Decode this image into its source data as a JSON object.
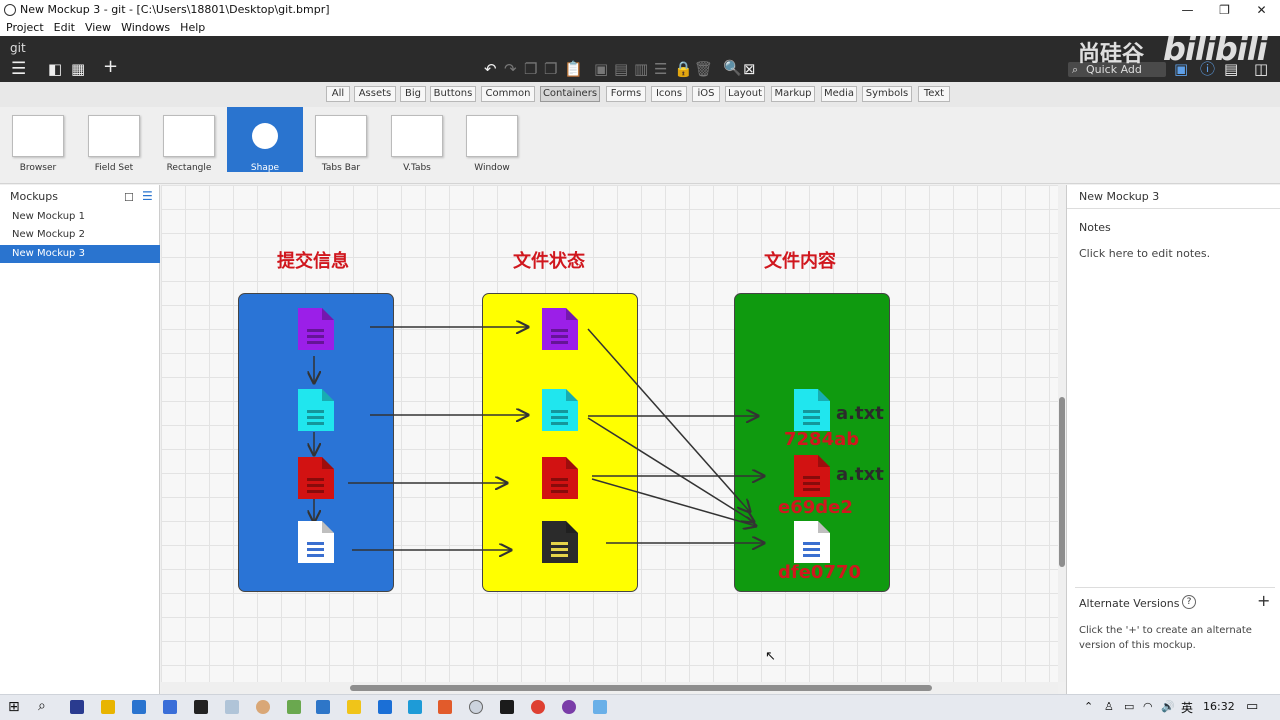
{
  "window": {
    "title": "New Mockup 3 - git - [C:\\Users\\18801\\Desktop\\git.bmpr]",
    "min": "—",
    "max": "❐",
    "close": "✕"
  },
  "menu": [
    "Project",
    "Edit",
    "View",
    "Windows",
    "Help"
  ],
  "toolbar": {
    "project_name": "git",
    "quick_add_placeholder": "Quick Add"
  },
  "watermark": {
    "cn": "尚硅谷",
    "bili": "bilibili"
  },
  "library_tabs": [
    {
      "label": "All",
      "active": false
    },
    {
      "label": "Assets",
      "active": false
    },
    {
      "label": "Big",
      "active": false
    },
    {
      "label": "Buttons",
      "active": false
    },
    {
      "label": "Common",
      "active": false
    },
    {
      "label": "Containers",
      "active": true
    },
    {
      "label": "Forms",
      "active": false
    },
    {
      "label": "Icons",
      "active": false
    },
    {
      "label": "iOS",
      "active": false
    },
    {
      "label": "Layout",
      "active": false
    },
    {
      "label": "Markup",
      "active": false
    },
    {
      "label": "Media",
      "active": false
    },
    {
      "label": "Symbols",
      "active": false
    },
    {
      "label": "Text",
      "active": false
    }
  ],
  "components": [
    {
      "label": "Browser",
      "selected": false
    },
    {
      "label": "Field Set",
      "selected": false
    },
    {
      "label": "Rectangle",
      "selected": false
    },
    {
      "label": "Shape",
      "selected": true
    },
    {
      "label": "Tabs Bar",
      "selected": false
    },
    {
      "label": "V.Tabs",
      "selected": false
    },
    {
      "label": "Window",
      "selected": false
    }
  ],
  "mockups": {
    "header": "Mockups",
    "items": [
      {
        "label": "New Mockup 1",
        "selected": false
      },
      {
        "label": "New Mockup 2",
        "selected": false
      },
      {
        "label": "New Mockup 3",
        "selected": true
      }
    ]
  },
  "right_panel": {
    "title": "New Mockup 3",
    "notes_label": "Notes",
    "notes_placeholder": "Click here to edit notes.",
    "alt_versions_label": "Alternate Versions",
    "alt_versions_help": "?",
    "alt_versions_add": "+",
    "alt_versions_text": "Click the '+' to create an alternate version of this mockup."
  },
  "diagram": {
    "titles": [
      "提交信息",
      "文件状态",
      "文件内容"
    ],
    "colors": {
      "commit_column": "#2a74d6",
      "status_column": "#ffff00",
      "content_column": "#0f9a0f",
      "purple": "#9b1fe8",
      "cyan": "#20e6ee",
      "red": "#d21212",
      "white": "#ffffff",
      "black": "#2b2b2b",
      "title_red": "#d0171e"
    },
    "commit_docs": [
      "purple-doc-icon",
      "cyan-doc-icon",
      "red-doc-icon",
      "white-doc-icon"
    ],
    "status_docs": [
      "purple-doc-icon",
      "cyan-doc-icon",
      "red-doc-icon",
      "black-doc-icon"
    ],
    "content_files": [
      {
        "name": "a.txt",
        "hash": "7284ab",
        "icon": "cyan-doc-icon"
      },
      {
        "name": "a.txt",
        "hash": "e69de2",
        "icon": "red-doc-icon"
      },
      {
        "name": "",
        "hash": "dfe0770",
        "icon": "white-doc-icon"
      }
    ]
  },
  "taskbar": {
    "ime": "英",
    "clock": "16:32"
  }
}
